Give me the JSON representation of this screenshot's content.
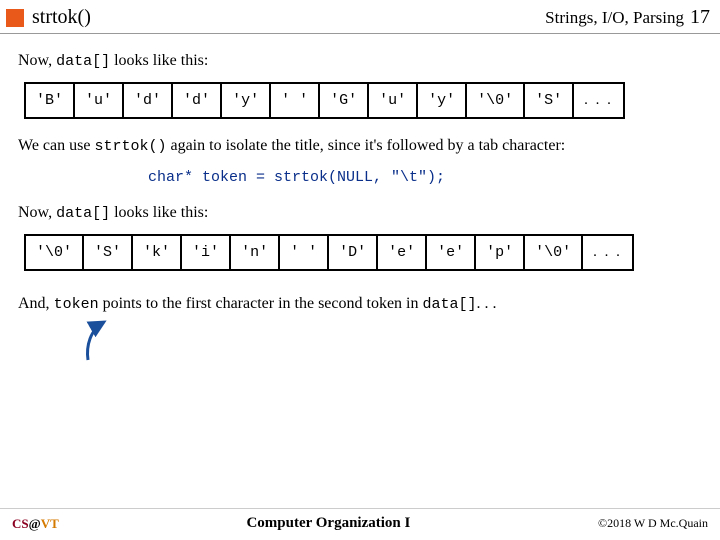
{
  "header": {
    "title": "strtok()",
    "section": "Strings, I/O, Parsing",
    "page": "17"
  },
  "para1_a": "Now, ",
  "para1_code": "data[]",
  "para1_b": " looks like this:",
  "array1": [
    "'B'",
    "'u'",
    "'d'",
    "'d'",
    "'y'",
    "' '",
    "'G'",
    "'u'",
    "'y'",
    "'\\0'",
    "'S'",
    ". . ."
  ],
  "para2_a": "We can use ",
  "para2_code": "strtok()",
  "para2_b": " again to isolate the title, since it's followed by a tab character:",
  "codeblock": "char* token = strtok(NULL, \"\\t\");",
  "para3_a": "Now, ",
  "para3_code": "data[]",
  "para3_b": " looks like this:",
  "array2": [
    "'\\0'",
    "'S'",
    "'k'",
    "'i'",
    "'n'",
    "' '",
    "'D'",
    "'e'",
    "'e'",
    "'p'",
    "'\\0'",
    ". . ."
  ],
  "para4_a": "And, ",
  "para4_code1": "token",
  "para4_b": " points to the first character in the second token in ",
  "para4_code2": "data[]",
  "para4_c": ". . .",
  "footer": {
    "left_cs": "CS",
    "left_at": "@",
    "left_vt": "VT",
    "center": "Computer Organization I",
    "right": "©2018 W D Mc.Quain"
  }
}
